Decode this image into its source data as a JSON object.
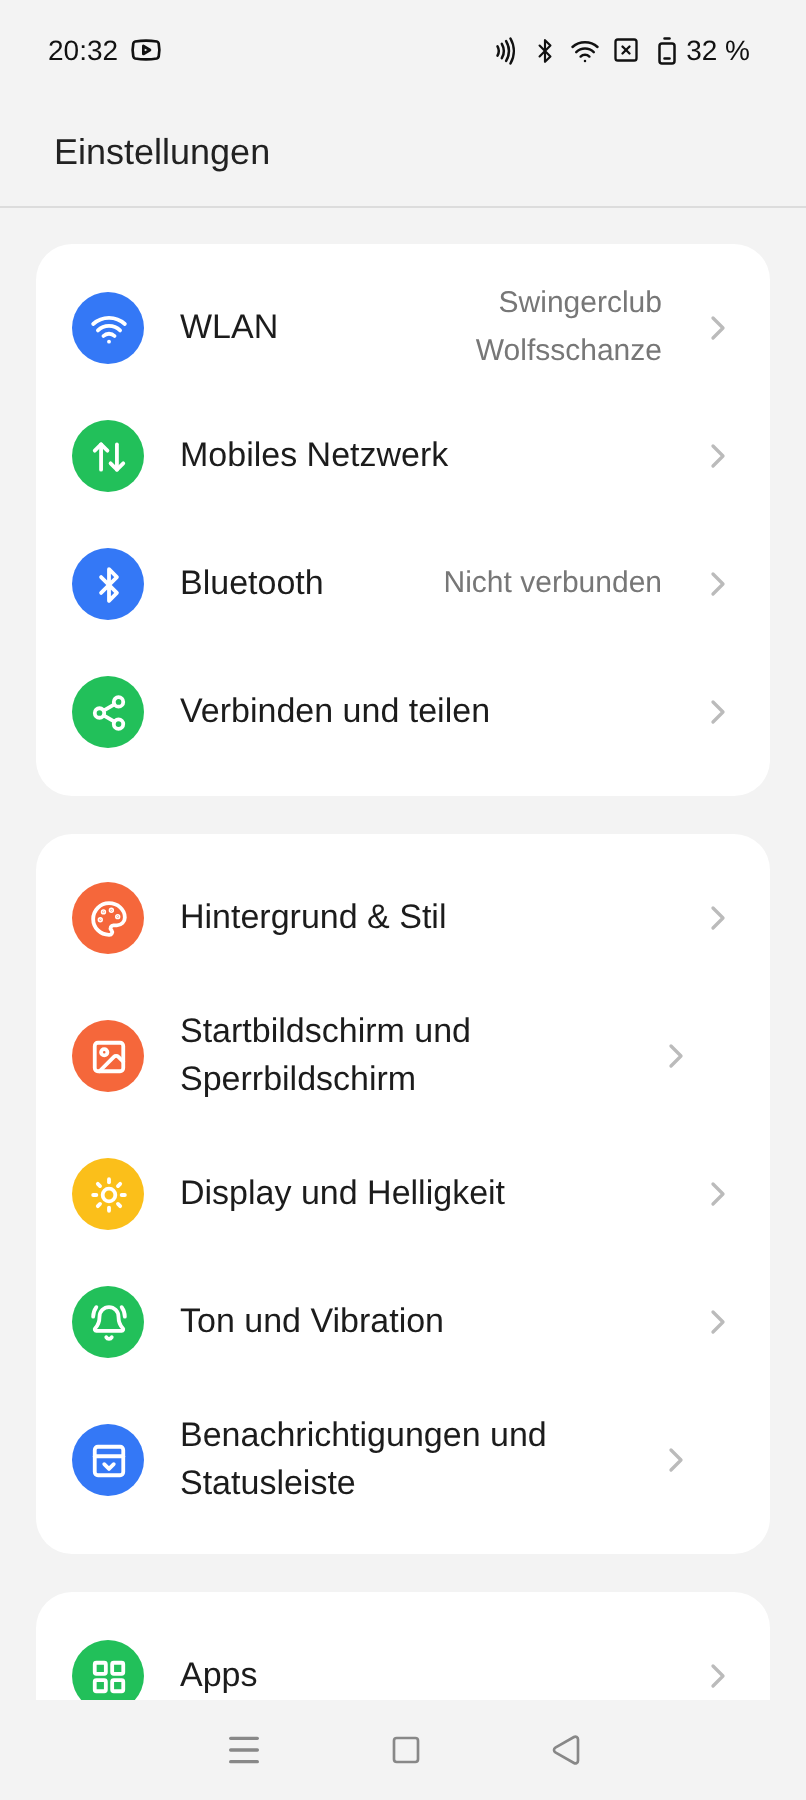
{
  "status_bar": {
    "time": "20:32",
    "battery": "32 %"
  },
  "header": {
    "title": "Einstellungen"
  },
  "groups": [
    {
      "items": [
        {
          "kind": "wifi",
          "color": "#3478f6",
          "label": "WLAN",
          "value": "Swingerclub Wolfsschanze"
        },
        {
          "kind": "mobile-data",
          "color": "#22c05a",
          "label": "Mobiles Netzwerk"
        },
        {
          "kind": "bluetooth",
          "color": "#3478f6",
          "label": "Bluetooth",
          "value": "Nicht verbunden"
        },
        {
          "kind": "share",
          "color": "#22c05a",
          "label": "Verbinden und teilen"
        }
      ]
    },
    {
      "items": [
        {
          "kind": "palette",
          "color": "#f5673b",
          "label": "Hintergrund & Stil"
        },
        {
          "kind": "image",
          "color": "#f5673b",
          "label": "Startbildschirm und Sperrbildschirm"
        },
        {
          "kind": "sun",
          "color": "#fbbf1a",
          "label": "Display und Helligkeit"
        },
        {
          "kind": "bell",
          "color": "#22c05a",
          "label": "Ton und Vibration"
        },
        {
          "kind": "notification",
          "color": "#3478f6",
          "label": "Benachrichtigungen und Statusleiste"
        }
      ]
    },
    {
      "items": [
        {
          "kind": "apps",
          "color": "#22c05a",
          "label": "Apps"
        }
      ]
    }
  ]
}
